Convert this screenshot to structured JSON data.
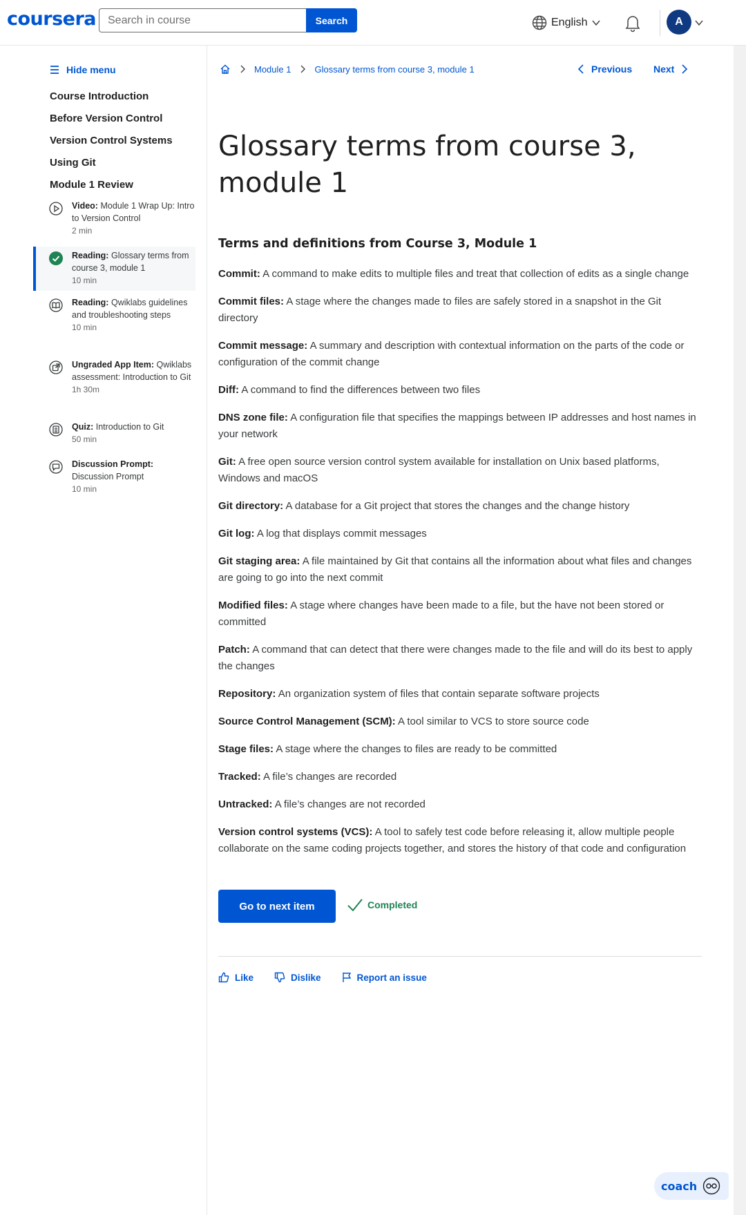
{
  "header": {
    "logo": "coursera",
    "search_placeholder": "Search in course",
    "search_button": "Search",
    "language": "English",
    "avatar_initial": "A"
  },
  "sidebar": {
    "hide_menu": "Hide menu",
    "sections": [
      "Course Introduction",
      "Before Version Control",
      "Version Control Systems",
      "Using Git",
      "Module 1 Review"
    ],
    "items": [
      {
        "type": "Video:",
        "title": "Module 1 Wrap Up: Intro to Version Control",
        "duration": "2 min",
        "icon": "play-icon"
      },
      {
        "type": "Reading:",
        "title": "Glossary terms from course 3, module 1",
        "duration": "10 min",
        "icon": "check-circle-icon",
        "active": true
      },
      {
        "type": "Reading:",
        "title": "Qwiklabs guidelines and troubleshooting steps",
        "duration": "10 min",
        "icon": "book-icon"
      },
      {
        "type": "Ungraded App Item:",
        "title": "Qwiklabs assessment: Introduction to Git",
        "duration": "1h 30m",
        "icon": "external-link-icon"
      },
      {
        "type": "Quiz:",
        "title": "Introduction to Git",
        "duration": "50 min",
        "icon": "quiz-icon"
      },
      {
        "type": "Discussion Prompt:",
        "title": "Discussion Prompt",
        "duration": "10 min",
        "icon": "chat-bubble-icon"
      }
    ]
  },
  "breadcrumb": {
    "module": "Module 1",
    "current": "Glossary terms from course 3, module 1"
  },
  "nav": {
    "previous": "Previous",
    "next": "Next"
  },
  "main": {
    "title": "Glossary terms from course 3, module 1",
    "subheading": "Terms and definitions from Course 3, Module 1",
    "terms": [
      {
        "term": "Commit:",
        "definition": "A command to make edits to multiple files and treat that collection of edits as a single change"
      },
      {
        "term": "Commit files:",
        "definition": "A stage where the changes made to files are safely stored in a snapshot in the Git directory"
      },
      {
        "term": "Commit message:",
        "definition": "A summary and description with contextual information on the parts of the code or configuration of the commit change"
      },
      {
        "term": "Diff:",
        "definition": "A command to find the differences between two files"
      },
      {
        "term": "DNS zone file:",
        "definition": "A configuration file that specifies the mappings between IP addresses and host names in your network"
      },
      {
        "term": "Git:",
        "definition": "A free open source version control system available for installation on Unix based platforms, Windows and macOS"
      },
      {
        "term": "Git directory:",
        "definition": "A database for a Git project that stores the changes and the change history"
      },
      {
        "term": "Git log:",
        "definition": "A log that displays commit messages"
      },
      {
        "term": "Git staging area:",
        "definition": "A file maintained by Git that contains all the information about what files and changes are going to go into the next commit"
      },
      {
        "term": "Modified files:",
        "definition": "A stage where changes have been made to a file, but the have not been stored or committed"
      },
      {
        "term": "Patch:",
        "definition": "A command that can detect that there were changes made to the file and will do its best to apply the changes"
      },
      {
        "term": "Repository:",
        "definition": "An organization system of files that contain separate software projects"
      },
      {
        "term": "Source Control Management (SCM):",
        "definition": "A tool similar to VCS to store source code"
      },
      {
        "term": "Stage files:",
        "definition": "A stage where the changes to files are ready to be committed"
      },
      {
        "term": "Tracked:",
        "definition": "A file’s changes are recorded"
      },
      {
        "term": "Untracked:",
        "definition": "A file’s changes are not recorded"
      },
      {
        "term": "Version control systems (VCS):",
        "definition": "A tool to safely test code before releasing it, allow multiple people collaborate on the same coding projects together, and stores the history of that code and configuration"
      }
    ],
    "next_item_button": "Go to next item",
    "completed": "Completed",
    "like": "Like",
    "dislike": "Dislike",
    "report": "Report an issue"
  },
  "coach": {
    "label": "coach"
  },
  "colors": {
    "brand": "#0056d2",
    "success": "#1f8354"
  }
}
